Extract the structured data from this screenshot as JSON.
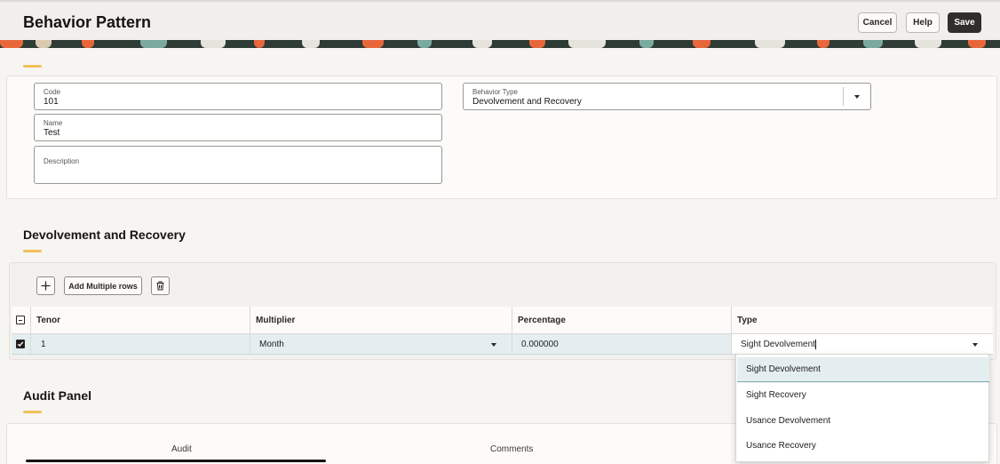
{
  "header": {
    "title": "Behavior Pattern",
    "cancel_label": "Cancel",
    "help_label": "Help",
    "save_label": "Save"
  },
  "form": {
    "code": {
      "label": "Code",
      "value": "101"
    },
    "name": {
      "label": "Name",
      "value": "Test"
    },
    "description": {
      "label": "Description",
      "value": ""
    },
    "behavior_type": {
      "label": "Behavior Type",
      "value": "Devolvement and Recovery"
    }
  },
  "devolvement_section": {
    "title": "Devolvement and Recovery",
    "toolbar": {
      "add_icon": "plus-icon",
      "add_multiple_label": "Add Multiple rows",
      "delete_icon": "trash-icon"
    },
    "columns": [
      "Tenor",
      "Multiplier",
      "Percentage",
      "Type"
    ],
    "rows": [
      {
        "tenor": "1",
        "multiplier": "Month",
        "percentage": "0.000000",
        "type": "Sight Devolvement",
        "selected": true
      }
    ]
  },
  "type_dropdown": {
    "options": [
      "Sight Devolvement",
      "Sight Recovery",
      "Usance Devolvement",
      "Usance Recovery"
    ],
    "active_index": 0
  },
  "audit_panel": {
    "title": "Audit Panel",
    "tabs": [
      "Audit",
      "Comments"
    ],
    "active_tab": "Audit"
  },
  "colors": {
    "accent": "#f0c05a",
    "primary_button": "#312d2a",
    "selected_row": "#e4eef1"
  }
}
